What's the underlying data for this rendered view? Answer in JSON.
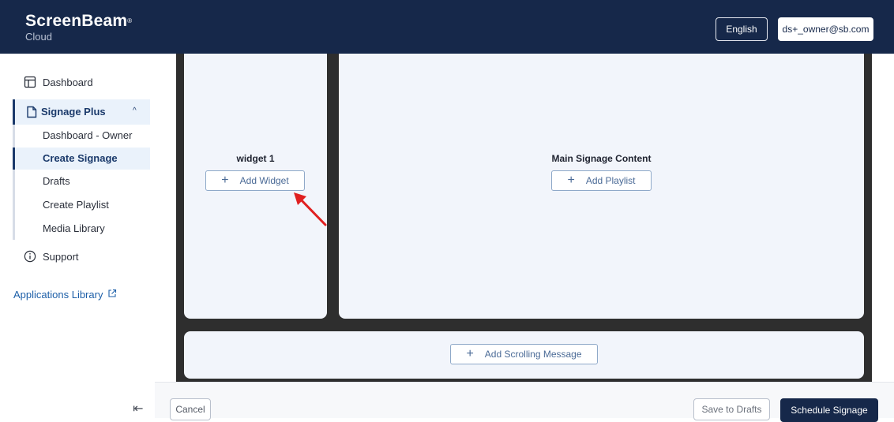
{
  "header": {
    "brand": "ScreenBeam",
    "brand_mark": "®",
    "brand_sub": "Cloud",
    "language": "English",
    "user_email": "ds+_owner@sb.com"
  },
  "sidebar": {
    "dashboard": "Dashboard",
    "signage_plus": "Signage Plus",
    "sub_items": [
      "Dashboard - Owner",
      "Create Signage",
      "Drafts",
      "Create Playlist",
      "Media Library"
    ],
    "active_item": "Create Signage",
    "support": "Support",
    "applications_library": "Applications Library",
    "collapse_icon": "collapse-left-icon"
  },
  "canvas": {
    "widget_title": "widget 1",
    "add_widget": "Add Widget",
    "main_title": "Main Signage Content",
    "add_playlist": "Add Playlist",
    "add_scrolling_message": "Add Scrolling Message"
  },
  "footer": {
    "cancel": "Cancel",
    "save_to_drafts": "Save to Drafts",
    "schedule_signage": "Schedule Signage"
  },
  "colors": {
    "topbar": "#16284a",
    "accent": "#1b3a6b",
    "annotation_arrow": "#e02020"
  }
}
